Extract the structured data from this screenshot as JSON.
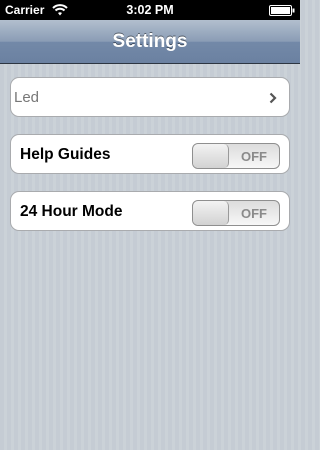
{
  "status_bar": {
    "carrier": "Carrier",
    "time": "3:02 PM",
    "wifi_icon": "wifi-icon",
    "battery_icon": "battery-icon"
  },
  "nav": {
    "title": "Settings"
  },
  "settings": {
    "led": {
      "label": "Led",
      "accessory_icon": "chevron-right-icon"
    },
    "help_guides": {
      "label": "Help Guides",
      "switch_label": "OFF",
      "state": "off"
    },
    "hour_24": {
      "label": "24 Hour Mode",
      "switch_label": "OFF",
      "state": "off"
    }
  }
}
